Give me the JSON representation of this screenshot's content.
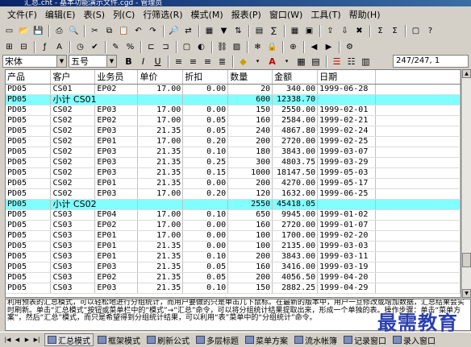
{
  "window": {
    "title": "汇总.cht - 基本功能演示文件.cgd - 管理员"
  },
  "menus": [
    "文件(F)",
    "编辑(E)",
    "表(S)",
    "列(C)",
    "行筛选(R)",
    "模式(M)",
    "报表(P)",
    "窗口(W)",
    "工具(T)",
    "帮助(H)"
  ],
  "toolbar1_icons": [
    "new-icon",
    "open-icon",
    "save-icon",
    "sep",
    "print-icon",
    "preview-icon",
    "sep",
    "cut-icon",
    "copy-icon",
    "paste-icon",
    "undo-icon",
    "redo-icon",
    "sep",
    "find-icon",
    "replace-icon",
    "sep",
    "chart-icon",
    "filter-icon",
    "sort-icon",
    "sep",
    "table-icon",
    "calc-icon",
    "sep",
    "grid-icon",
    "form-icon",
    "sep",
    "export-icon",
    "import-icon",
    "close-icon",
    "sep",
    "sum-icon",
    "sigma-icon",
    "sep",
    "window-icon",
    "help-icon"
  ],
  "toolbar2_icons": [
    "insert-row-icon",
    "delete-row-icon",
    "sep",
    "fx-icon",
    "font-icon",
    "sep",
    "clock-icon",
    "check-icon",
    "sep",
    "edit-icon",
    "percent-icon",
    "sep",
    "merge-icon",
    "split-icon",
    "sep",
    "border-icon",
    "color-icon",
    "sep",
    "link-icon",
    "image-icon",
    "sep",
    "freeze-icon",
    "lock-icon",
    "sep",
    "zoom-icon",
    "sep",
    "arrow-left-icon",
    "arrow-right-icon",
    "sep",
    "settings-icon"
  ],
  "format": {
    "font_name": "宋体",
    "font_size": "五号",
    "bold": "B",
    "italic": "I",
    "underline": "U",
    "cell_ref": "247/247, 1"
  },
  "table": {
    "headers": [
      "产品",
      "客户",
      "业务员",
      "单价",
      "折扣",
      "数量",
      "金额",
      "日期"
    ],
    "rows": [
      {
        "type": "data",
        "cells": [
          "PD05",
          "CS01",
          "EP02",
          "17.00",
          "0.00",
          "20",
          "340.00",
          "1999-06-28"
        ]
      },
      {
        "type": "subtotal",
        "label": "小计 CS01",
        "qty": "600",
        "amount": "12338.70",
        "product": "PD05"
      },
      {
        "type": "data",
        "cells": [
          "PD05",
          "CS02",
          "EP03",
          "17.00",
          "0.00",
          "150",
          "2550.00",
          "1999-02-01"
        ]
      },
      {
        "type": "data",
        "cells": [
          "PD05",
          "CS02",
          "EP02",
          "17.00",
          "0.05",
          "160",
          "2584.00",
          "1999-02-21"
        ]
      },
      {
        "type": "data",
        "cells": [
          "PD05",
          "CS02",
          "EP03",
          "21.35",
          "0.05",
          "240",
          "4867.80",
          "1999-02-24"
        ]
      },
      {
        "type": "data",
        "cells": [
          "PD05",
          "CS02",
          "EP01",
          "17.00",
          "0.20",
          "200",
          "2720.00",
          "1999-02-25"
        ]
      },
      {
        "type": "data",
        "cells": [
          "PD05",
          "CS02",
          "EP03",
          "21.35",
          "0.10",
          "180",
          "3843.00",
          "1999-03-07"
        ]
      },
      {
        "type": "data",
        "cells": [
          "PD05",
          "CS02",
          "EP03",
          "21.35",
          "0.25",
          "300",
          "4803.75",
          "1999-03-29"
        ]
      },
      {
        "type": "data",
        "cells": [
          "PD05",
          "CS02",
          "EP03",
          "21.35",
          "0.15",
          "1000",
          "18147.50",
          "1999-05-03"
        ]
      },
      {
        "type": "data",
        "cells": [
          "PD05",
          "CS02",
          "EP01",
          "21.35",
          "0.00",
          "200",
          "4270.00",
          "1999-05-17"
        ]
      },
      {
        "type": "data",
        "cells": [
          "PD05",
          "CS02",
          "EP03",
          "17.00",
          "0.20",
          "120",
          "1632.00",
          "1999-06-25"
        ]
      },
      {
        "type": "subtotal",
        "label": "小计 CS02",
        "qty": "2550",
        "amount": "45418.05",
        "product": "PD05"
      },
      {
        "type": "data",
        "cells": [
          "PD05",
          "CS03",
          "EP04",
          "17.00",
          "0.10",
          "650",
          "9945.00",
          "1999-01-02"
        ]
      },
      {
        "type": "data",
        "cells": [
          "PD05",
          "CS03",
          "EP02",
          "17.00",
          "0.00",
          "160",
          "2720.00",
          "1999-01-07"
        ]
      },
      {
        "type": "data",
        "cells": [
          "PD05",
          "CS03",
          "EP01",
          "17.00",
          "0.00",
          "100",
          "1700.00",
          "1999-02-20"
        ]
      },
      {
        "type": "data",
        "cells": [
          "PD05",
          "CS03",
          "EP01",
          "21.35",
          "0.00",
          "100",
          "2135.00",
          "1999-03-03"
        ]
      },
      {
        "type": "data",
        "cells": [
          "PD05",
          "CS03",
          "EP01",
          "21.35",
          "0.10",
          "200",
          "3843.00",
          "1999-03-11"
        ]
      },
      {
        "type": "data",
        "cells": [
          "PD05",
          "CS03",
          "EP03",
          "21.35",
          "0.05",
          "160",
          "3416.00",
          "1999-03-19"
        ]
      },
      {
        "type": "data",
        "cells": [
          "PD05",
          "CS03",
          "EP02",
          "21.35",
          "0.05",
          "200",
          "4056.50",
          "1999-04-20"
        ]
      },
      {
        "type": "data",
        "cells": [
          "PD05",
          "CS03",
          "EP03",
          "21.35",
          "0.10",
          "150",
          "2882.25",
          "1999-04-29"
        ]
      }
    ]
  },
  "description": "利用预表的汇总模式，可以轻松地进行分组统计，而用户要做的只是单击几下鼠标。在最新的版本中，用户一旦修改或增加数据，汇总结果会实时刷新。单击“汇总模式”按钮或菜单栏中的“模式”→“汇总”命令，可以将分组统计结果提取出来，形成一个单独的表。操作步骤：单击“菜单方案”，然后“汇总”模式，而只是希望得到分组统计结果，可以利用“表”菜单中的“分组统计”命令。",
  "watermark": "最需教育",
  "bottom_tabs": [
    {
      "label": "汇总模式",
      "active": true
    },
    {
      "label": "框架模式",
      "active": false
    },
    {
      "label": "刷新公式",
      "active": false
    },
    {
      "label": "多层标题",
      "active": false
    },
    {
      "label": "菜单方案",
      "active": false
    },
    {
      "label": "流水帐簿",
      "active": false
    },
    {
      "label": "记录窗口",
      "active": false
    },
    {
      "label": "录入窗口",
      "active": false
    }
  ],
  "colors": {
    "subtotal_bg": "#80ffff",
    "chrome": "#d4d0c8",
    "watermark": "#2a3fb0"
  }
}
